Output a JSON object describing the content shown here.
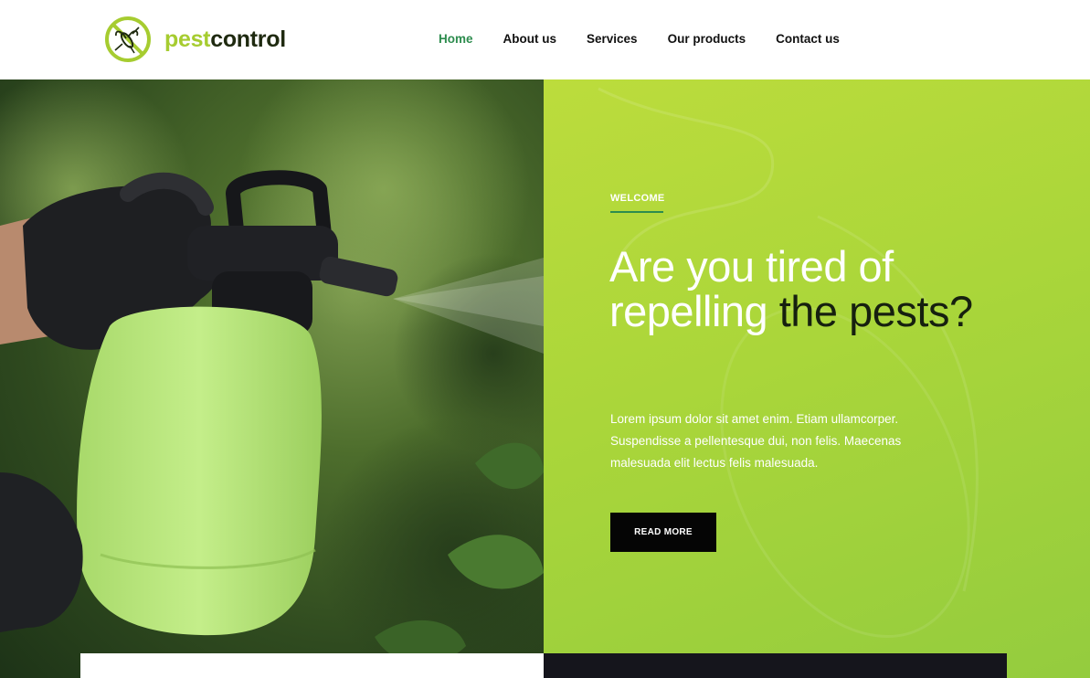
{
  "header": {
    "logo_part1": "pest",
    "logo_part2": "control",
    "logo_icon": "mosquito-no-icon",
    "nav": [
      {
        "label": "Home",
        "active": true
      },
      {
        "label": "About us",
        "active": false
      },
      {
        "label": "Services",
        "active": false
      },
      {
        "label": "Our products",
        "active": false
      },
      {
        "label": "Contact us",
        "active": false
      }
    ]
  },
  "hero": {
    "eyebrow": "WELCOME",
    "headline_light": "Are you tired of repelling ",
    "headline_dark": "the pests?",
    "text": "Lorem ipsum dolor sit amet enim. Etiam ullamcorper. Suspendisse a pellentesque dui, non felis. Maecenas malesuada elit lectus felis malesuada.",
    "button": "READ MORE",
    "image": "spray-bottle-photo"
  },
  "colors": {
    "accent_green": "#a6cc30",
    "nav_active": "#2d8c4e",
    "hero_panel": "#aad63a",
    "button_bg": "#050505",
    "dark_card": "#15151c"
  }
}
